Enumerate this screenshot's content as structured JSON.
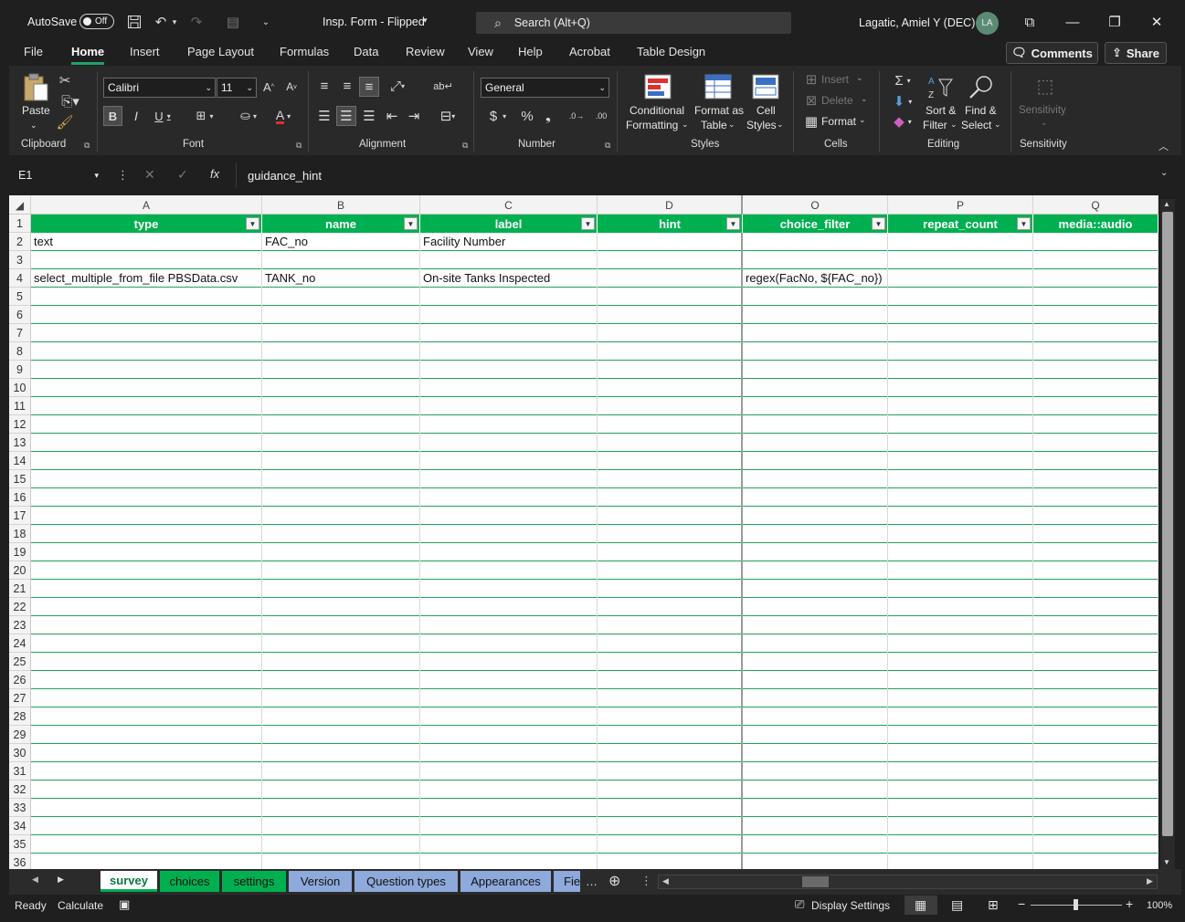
{
  "titlebar": {
    "autosave_label": "AutoSave",
    "autosave_state": "Off",
    "doc_title": "Insp. Form - Flipped",
    "search_placeholder": "Search (Alt+Q)",
    "user_name": "Lagatic, Amiel Y (DEC)",
    "user_initials": "LA"
  },
  "ribbon_tabs": [
    "File",
    "Home",
    "Insert",
    "Page Layout",
    "Formulas",
    "Data",
    "Review",
    "View",
    "Help",
    "Acrobat",
    "Table Design"
  ],
  "active_tab": "Home",
  "header_buttons": {
    "comments": "Comments",
    "share": "Share"
  },
  "ribbon": {
    "clipboard": {
      "paste": "Paste",
      "group": "Clipboard"
    },
    "font": {
      "name": "Calibri",
      "size": "11",
      "group": "Font"
    },
    "alignment": {
      "group": "Alignment"
    },
    "number": {
      "format": "General",
      "group": "Number"
    },
    "styles": {
      "conditional_1": "Conditional",
      "conditional_2": "Formatting",
      "format_table_1": "Format as",
      "format_table_2": "Table",
      "cell_styles_1": "Cell",
      "cell_styles_2": "Styles",
      "group": "Styles"
    },
    "cells": {
      "insert": "Insert",
      "delete": "Delete",
      "format": "Format",
      "group": "Cells"
    },
    "editing": {
      "sort_1": "Sort &",
      "sort_2": "Filter",
      "find_1": "Find &",
      "find_2": "Select",
      "group": "Editing"
    },
    "sensitivity": {
      "button": "Sensitivity",
      "group": "Sensitivity"
    }
  },
  "formula_bar": {
    "name_box": "E1",
    "fx": "fx",
    "value": "guidance_hint"
  },
  "columns": [
    {
      "letter": "A",
      "header": "type"
    },
    {
      "letter": "B",
      "header": "name"
    },
    {
      "letter": "C",
      "header": "label"
    },
    {
      "letter": "D",
      "header": "hint"
    },
    {
      "letter": "O",
      "header": "choice_filter"
    },
    {
      "letter": "P",
      "header": "repeat_count"
    },
    {
      "letter": "Q",
      "header": "media::audio"
    }
  ],
  "row_numbers": [
    "1",
    "2",
    "3",
    "4",
    "5",
    "6",
    "7",
    "8",
    "9",
    "10",
    "11",
    "12",
    "13",
    "14",
    "15",
    "16",
    "17",
    "18",
    "19",
    "20",
    "21",
    "22",
    "23",
    "24",
    "25",
    "26",
    "27",
    "28",
    "29",
    "30",
    "31",
    "32",
    "33",
    "34",
    "35",
    "36"
  ],
  "data_rows": [
    {
      "row": "2",
      "A": "text",
      "B": "FAC_no",
      "C": "Facility Number",
      "D": "",
      "O": "",
      "P": "",
      "Q": ""
    },
    {
      "row": "3",
      "A": "",
      "B": "",
      "C": "",
      "D": "",
      "O": "",
      "P": "",
      "Q": ""
    },
    {
      "row": "4",
      "A": "select_multiple_from_file PBSData.csv",
      "B": "TANK_no",
      "C": "On-site Tanks Inspected",
      "D": "",
      "O": "regex(FacNo, ${FAC_no})",
      "P": "",
      "Q": ""
    }
  ],
  "sheet_tabs": [
    {
      "label": "survey",
      "style": "active"
    },
    {
      "label": "choices",
      "style": "green"
    },
    {
      "label": "settings",
      "style": "green"
    },
    {
      "label": "Version",
      "style": "blue"
    },
    {
      "label": "Question types",
      "style": "blue"
    },
    {
      "label": "Appearances",
      "style": "blue"
    },
    {
      "label": "Fie",
      "style": "blue"
    }
  ],
  "status_bar": {
    "ready": "Ready",
    "calculate": "Calculate",
    "display_settings": "Display Settings",
    "zoom": "100%"
  }
}
